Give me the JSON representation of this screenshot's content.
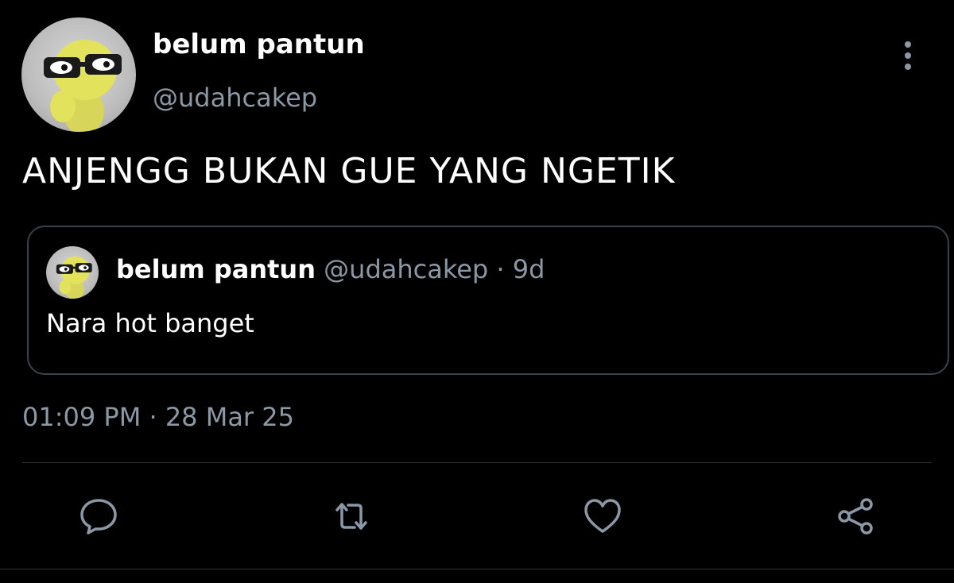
{
  "tweet": {
    "author_name": "belum pantun",
    "author_handle": "@udahcakep",
    "text": "ANJENGG BUKAN GUE YANG NGETIK",
    "timestamp": "01:09 PM · 28 Mar 25",
    "more_icon": "more-vertical-icon"
  },
  "quote": {
    "author_name": "belum pantun",
    "author_handle": "@udahcakep",
    "separator": "·",
    "age": "9d",
    "text": "Nara hot banget"
  },
  "actions": [
    {
      "name": "reply",
      "icon": "comment-bubble-icon"
    },
    {
      "name": "retweet",
      "icon": "retweet-arrows-icon"
    },
    {
      "name": "like",
      "icon": "heart-icon"
    },
    {
      "name": "share",
      "icon": "share-nodes-icon"
    }
  ],
  "colors": {
    "background": "#000000",
    "primary_text": "#ffffff",
    "secondary_text": "#8b98a5",
    "border": "#3b4148",
    "avatar_figure": "#e3e25c"
  }
}
